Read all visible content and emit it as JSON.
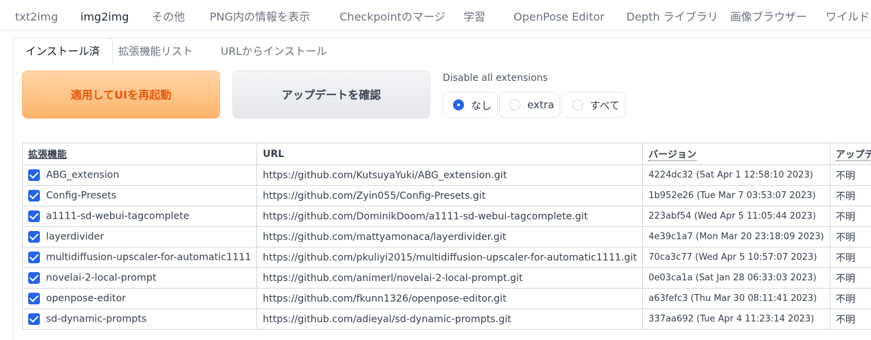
{
  "top_tabs": [
    "txt2img",
    "img2img",
    "その他",
    "PNG内の情報を表示",
    "Checkpointのマージ",
    "学習",
    "OpenPose Editor",
    "Depth ライブラリ",
    "画像ブラウザー",
    "ワイルドカ"
  ],
  "sub_tabs": [
    "インストール済",
    "拡張機能リスト",
    "URLからインストール"
  ],
  "buttons": {
    "restart": "適用してUIを再起動",
    "check_updates": "アップデートを確認"
  },
  "disable": {
    "label": "Disable all extensions",
    "options": [
      "なし",
      "extra",
      "すべて"
    ],
    "selected": "なし"
  },
  "table": {
    "headers": {
      "extension": "拡張機能",
      "url": "URL",
      "version": "バージョン",
      "update": "アップデート"
    },
    "rows": [
      {
        "checked": true,
        "name": "ABG_extension",
        "url": "https://github.com/KutsuyaYuki/ABG_extension.git",
        "version": "4224dc32 (Sat Apr 1 12:58:10 2023)",
        "update": "不明"
      },
      {
        "checked": true,
        "name": "Config-Presets",
        "url": "https://github.com/Zyin055/Config-Presets.git",
        "version": "1b952e26 (Tue Mar 7 03:53:07 2023)",
        "update": "不明"
      },
      {
        "checked": true,
        "name": "a1111-sd-webui-tagcomplete",
        "url": "https://github.com/DominikDoom/a1111-sd-webui-tagcomplete.git",
        "version": "223abf54 (Wed Apr 5 11:05:44 2023)",
        "update": "不明"
      },
      {
        "checked": true,
        "name": "layerdivider",
        "url": "https://github.com/mattyamonaca/layerdivider.git",
        "version": "4e39c1a7 (Mon Mar 20 23:18:09 2023)",
        "update": "不明"
      },
      {
        "checked": true,
        "name": "multidiffusion-upscaler-for-automatic1111",
        "url": "https://github.com/pkuliyi2015/multidiffusion-upscaler-for-automatic1111.git",
        "version": "70ca3c77 (Wed Apr 5 10:57:07 2023)",
        "update": "不明"
      },
      {
        "checked": true,
        "name": "novelai-2-local-prompt",
        "url": "https://github.com/animerl/novelai-2-local-prompt.git",
        "version": "0e03ca1a (Sat Jan 28 06:33:03 2023)",
        "update": "不明"
      },
      {
        "checked": true,
        "name": "openpose-editor",
        "url": "https://github.com/fkunn1326/openpose-editor.git",
        "version": "a63fefc3 (Thu Mar 30 08:11:41 2023)",
        "update": "不明"
      },
      {
        "checked": true,
        "name": "sd-dynamic-prompts",
        "url": "https://github.com/adieyal/sd-dynamic-prompts.git",
        "version": "337aa692 (Tue Apr 4 11:23:14 2023)",
        "update": "不明"
      }
    ]
  },
  "colors": {
    "accent": "#2563eb",
    "primary_button_text": "#ea580c",
    "primary_button_bg": "#fbb46a"
  }
}
